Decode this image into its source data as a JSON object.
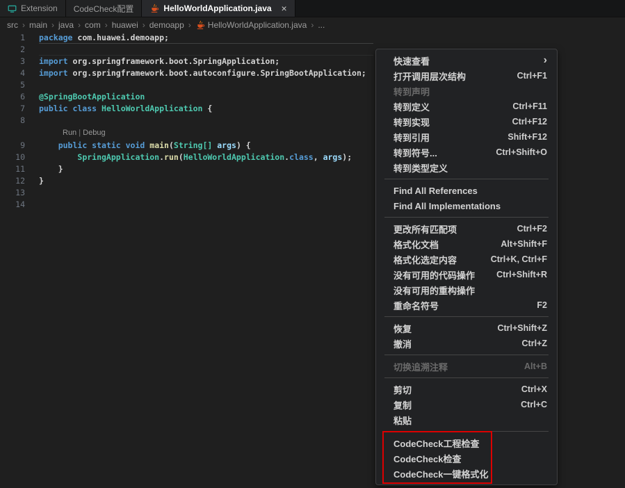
{
  "tabs": [
    {
      "name": "tab-extension",
      "label": "Extension",
      "icon": "monitor",
      "active": false,
      "close": false
    },
    {
      "name": "tab-codecheck-config",
      "label": "CodeCheck配置",
      "icon": null,
      "active": false,
      "close": false
    },
    {
      "name": "tab-helloworldapplication-java",
      "label": "HelloWorldApplication.java",
      "icon": "java",
      "active": true,
      "close": true,
      "close_glyph": "×"
    }
  ],
  "breadcrumb": {
    "separator": "›",
    "items": [
      {
        "label": "src"
      },
      {
        "label": "main"
      },
      {
        "label": "java"
      },
      {
        "label": "com"
      },
      {
        "label": "huawei"
      },
      {
        "label": "demoapp"
      },
      {
        "label": "HelloWorldApplication.java",
        "icon": "java"
      },
      {
        "label": "..."
      }
    ]
  },
  "editor": {
    "current_line": 2,
    "codelens": {
      "links": [
        "Run",
        "Debug"
      ],
      "separator": "|"
    },
    "lines": [
      {
        "n": 1,
        "t": [
          [
            "kw",
            "package"
          ],
          [
            "pl",
            " com.huawei.demoapp;"
          ]
        ]
      },
      {
        "n": 2,
        "t": [],
        "current": true
      },
      {
        "n": 3,
        "t": [
          [
            "kw",
            "import"
          ],
          [
            "pl",
            " org.springframework.boot.SpringApplication;"
          ]
        ]
      },
      {
        "n": 4,
        "t": [
          [
            "kw",
            "import"
          ],
          [
            "pl",
            " org.springframework.boot.autoconfigure.SpringBootApplication;"
          ]
        ]
      },
      {
        "n": 5,
        "t": []
      },
      {
        "n": 6,
        "t": [
          [
            "type",
            "@SpringBootApplication"
          ]
        ]
      },
      {
        "n": 7,
        "t": [
          [
            "kw",
            "public class "
          ],
          [
            "type",
            "HelloWorldApplication"
          ],
          [
            "pl",
            " {"
          ]
        ]
      },
      {
        "n": 8,
        "t": []
      },
      {
        "codelens": true
      },
      {
        "n": 9,
        "t": [
          [
            "pl",
            "    "
          ],
          [
            "kw",
            "public static void "
          ],
          [
            "fn",
            "main"
          ],
          [
            "pl",
            "("
          ],
          [
            "type",
            "String[]"
          ],
          [
            "pl",
            " "
          ],
          [
            "var",
            "args"
          ],
          [
            "pl",
            ") {"
          ]
        ]
      },
      {
        "n": 10,
        "t": [
          [
            "pl",
            "        "
          ],
          [
            "type",
            "SpringApplication"
          ],
          [
            "pl",
            "."
          ],
          [
            "fn",
            "run"
          ],
          [
            "pl",
            "("
          ],
          [
            "type",
            "HelloWorldApplication"
          ],
          [
            "pl",
            "."
          ],
          [
            "kw",
            "class"
          ],
          [
            "pl",
            ", "
          ],
          [
            "var",
            "args"
          ],
          [
            "pl",
            ");"
          ]
        ]
      },
      {
        "n": 11,
        "t": [
          [
            "pl",
            "    }"
          ]
        ]
      },
      {
        "n": 12,
        "t": [
          [
            "pl",
            "}"
          ]
        ]
      },
      {
        "n": 13,
        "t": []
      },
      {
        "n": 14,
        "t": []
      }
    ]
  },
  "context_menu": {
    "groups": [
      {
        "items": [
          {
            "name": "menu-item-peek",
            "label": "快速查看",
            "submenu": true
          },
          {
            "name": "menu-item-open-call-hierarchy",
            "label": "打开调用层次结构",
            "shortcut": "Ctrl+F1"
          },
          {
            "name": "menu-item-go-to-declaration",
            "label": "转到声明",
            "disabled": true
          },
          {
            "name": "menu-item-go-to-definition",
            "label": "转到定义",
            "shortcut": "Ctrl+F11"
          },
          {
            "name": "menu-item-go-to-implementations",
            "label": "转到实现",
            "shortcut": "Ctrl+F12"
          },
          {
            "name": "menu-item-go-to-references",
            "label": "转到引用",
            "shortcut": "Shift+F12"
          },
          {
            "name": "menu-item-go-to-symbol",
            "label": "转到符号...",
            "shortcut": "Ctrl+Shift+O"
          },
          {
            "name": "menu-item-go-to-type-definition",
            "label": "转到类型定义"
          }
        ]
      },
      {
        "items": [
          {
            "name": "menu-item-find-all-references",
            "label": "Find All References"
          },
          {
            "name": "menu-item-find-all-implementations",
            "label": "Find All Implementations"
          }
        ]
      },
      {
        "items": [
          {
            "name": "menu-item-change-all-occurrences",
            "label": "更改所有匹配项",
            "shortcut": "Ctrl+F2"
          },
          {
            "name": "menu-item-format-document",
            "label": "格式化文档",
            "shortcut": "Alt+Shift+F"
          },
          {
            "name": "menu-item-format-selection",
            "label": "格式化选定内容",
            "shortcut": "Ctrl+K, Ctrl+F"
          },
          {
            "name": "menu-item-no-code-actions",
            "label": "没有可用的代码操作",
            "shortcut": "Ctrl+Shift+R"
          },
          {
            "name": "menu-item-no-refactorings",
            "label": "没有可用的重构操作"
          },
          {
            "name": "menu-item-rename-symbol",
            "label": "重命名符号",
            "shortcut": "F2"
          }
        ]
      },
      {
        "items": [
          {
            "name": "menu-item-redo",
            "label": "恢复",
            "shortcut": "Ctrl+Shift+Z"
          },
          {
            "name": "menu-item-undo",
            "label": "撤消",
            "shortcut": "Ctrl+Z"
          }
        ]
      },
      {
        "items": [
          {
            "name": "menu-item-toggle-blame-annotations",
            "label": "切换追溯注释",
            "shortcut": "Alt+B",
            "disabled": true
          }
        ]
      },
      {
        "items": [
          {
            "name": "menu-item-cut",
            "label": "剪切",
            "shortcut": "Ctrl+X"
          },
          {
            "name": "menu-item-copy",
            "label": "复制",
            "shortcut": "Ctrl+C"
          },
          {
            "name": "menu-item-paste",
            "label": "粘贴"
          }
        ]
      },
      {
        "highlighted": true,
        "items": [
          {
            "name": "menu-item-codecheck-project-check",
            "label": "CodeCheck工程检查"
          },
          {
            "name": "menu-item-codecheck-check",
            "label": "CodeCheck检查"
          },
          {
            "name": "menu-item-codecheck-one-click-format",
            "label": "CodeCheck一键格式化"
          }
        ]
      }
    ],
    "submenu_glyph": "›"
  },
  "colors": {
    "annotation_red": "#dc0000",
    "keyword": "#569cd6",
    "type": "#4ec9b0",
    "function": "#dcdcaa",
    "variable": "#9cdcfe",
    "plain_text": "#d4d4d4",
    "editor_bg": "#1f1f1f",
    "menu_bg": "#212224",
    "java_icon_orange": "#d94f1e",
    "extension_icon_teal": "#26a69a"
  }
}
